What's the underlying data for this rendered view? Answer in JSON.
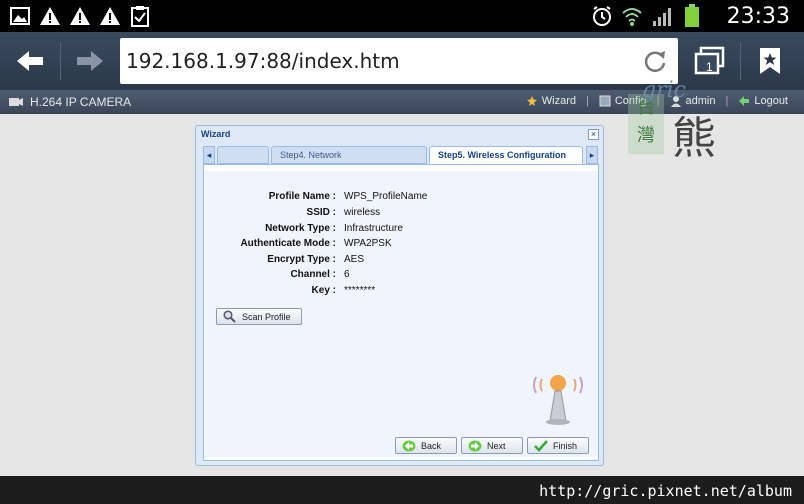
{
  "status_bar": {
    "time": "23:33",
    "left_icons": [
      "gallery-icon",
      "warning-icon",
      "warning-icon",
      "warning-icon",
      "clipboard-icon"
    ],
    "right_icons": [
      "alarm-icon",
      "wifi-icon",
      "signal-icon",
      "battery-icon"
    ]
  },
  "browser": {
    "url": "192.168.1.97:88/index.htm",
    "tab_count": "1"
  },
  "camera_header": {
    "title": "H.264 IP CAMERA",
    "menu": {
      "wizard": "Wizard",
      "config": "Config",
      "admin": "admin",
      "logout": "Logout"
    }
  },
  "watermark": {
    "text_top": "gric",
    "text_left_1": "台",
    "text_left_2": "灣",
    "text_bear": "熊"
  },
  "wizard": {
    "title": "Wizard",
    "close": "×",
    "steps": {
      "blank": "",
      "step4": "Step4. Network",
      "step5": "Step5. Wireless Configuration"
    },
    "fields": [
      {
        "label": "Profile Name :",
        "value": "WPS_ProfileName"
      },
      {
        "label": "SSID :",
        "value": "wireless"
      },
      {
        "label": "Network Type :",
        "value": "Infrastructure"
      },
      {
        "label": "Authenticate Mode :",
        "value": "WPA2PSK"
      },
      {
        "label": "Encrypt Type :",
        "value": "AES"
      },
      {
        "label": "Channel :",
        "value": "6"
      },
      {
        "label": "Key :",
        "value": "********"
      }
    ],
    "scan_button": "Scan Profile",
    "back_button": "Back",
    "next_button": "Next",
    "finish_button": "Finish"
  },
  "footer": {
    "credit": "http://gric.pixnet.net/album"
  },
  "colors": {
    "panel_border": "#99bbe8",
    "title_text": "#15428b",
    "page_bg": "#e6e6e6",
    "browser_bar": "#2a3848"
  }
}
